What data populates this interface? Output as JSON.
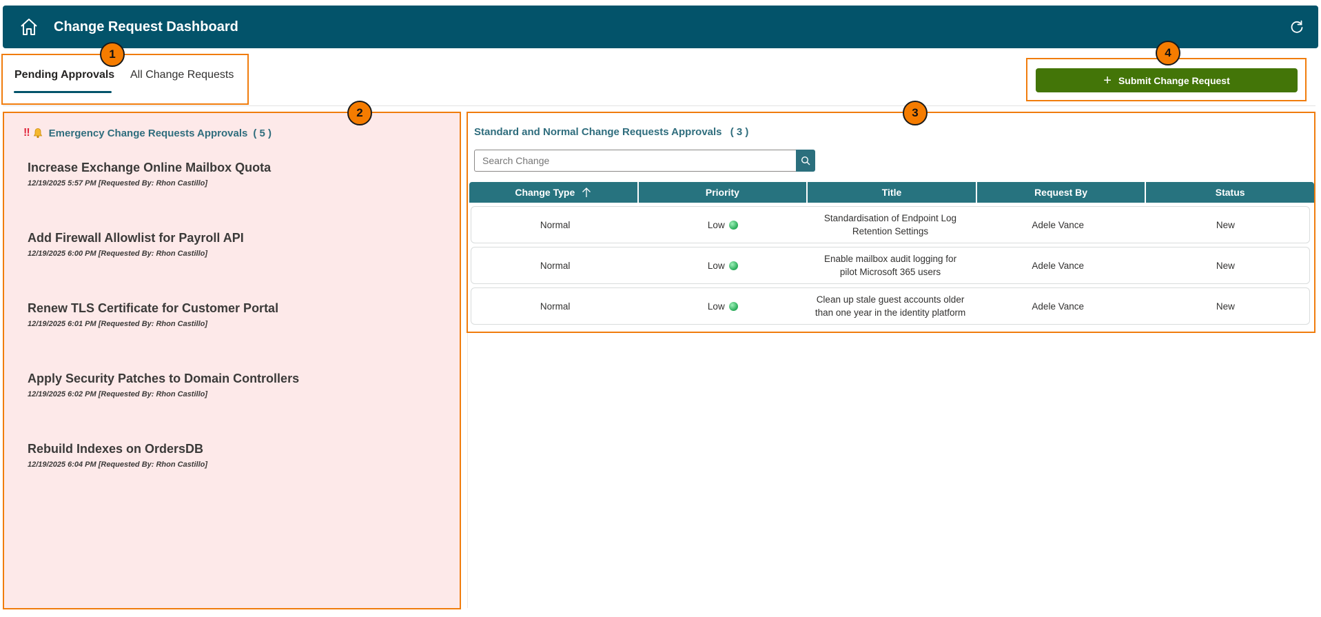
{
  "header": {
    "title": "Change Request Dashboard"
  },
  "tabs": [
    {
      "label": "Pending Approvals",
      "active": true
    },
    {
      "label": "All Change Requests",
      "active": false
    }
  ],
  "submit_button": {
    "label": "Submit Change Request"
  },
  "emergency": {
    "icon_marks": "‼",
    "title": "Emergency Change Requests Approvals",
    "count": "( 5 )",
    "items": [
      {
        "title": "Increase Exchange Online Mailbox Quota",
        "meta": "12/19/2025 5:57 PM [Requested By: Rhon Castillo]"
      },
      {
        "title": "Add Firewall Allowlist for Payroll API",
        "meta": "12/19/2025 6:00 PM [Requested By: Rhon Castillo]"
      },
      {
        "title": "Renew TLS Certificate for Customer Portal",
        "meta": "12/19/2025 6:01 PM [Requested By: Rhon Castillo]"
      },
      {
        "title": "Apply Security Patches to Domain Controllers",
        "meta": "12/19/2025 6:02 PM [Requested By: Rhon Castillo]"
      },
      {
        "title": "Rebuild Indexes on OrdersDB",
        "meta": "12/19/2025 6:04 PM [Requested By: Rhon Castillo]"
      }
    ]
  },
  "standard": {
    "title": "Standard and Normal Change Requests Approvals",
    "count": "( 3 )",
    "search_placeholder": "Search Change",
    "columns": [
      "Change Type",
      "Priority",
      "Title",
      "Request By",
      "Status"
    ],
    "rows": [
      {
        "change_type": "Normal",
        "priority": "Low",
        "title": "Standardisation of Endpoint Log Retention Settings",
        "request_by": "Adele Vance",
        "status": "New"
      },
      {
        "change_type": "Normal",
        "priority": "Low",
        "title": "Enable mailbox audit logging for pilot Microsoft 365 users",
        "request_by": "Adele Vance",
        "status": "New"
      },
      {
        "change_type": "Normal",
        "priority": "Low",
        "title": "Clean up stale guest accounts older than one year in the identity platform",
        "request_by": "Adele Vance",
        "status": "New"
      }
    ]
  },
  "callouts": [
    "1",
    "2",
    "3",
    "4"
  ],
  "colors": {
    "header": "#03536a",
    "submit": "#437508",
    "table_header": "#27737f",
    "emergency_bg": "#fde9e9",
    "callout": "#f07c0c",
    "priority_low": "#2fb05e"
  }
}
